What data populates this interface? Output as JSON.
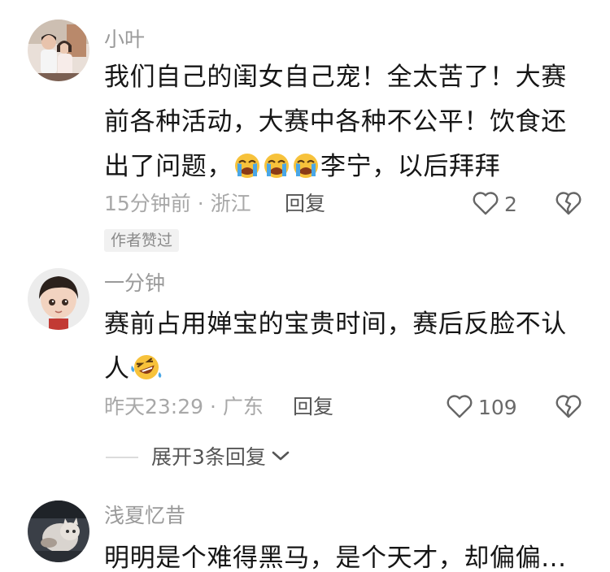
{
  "comments": [
    {
      "username": "小叶",
      "text_a": "我们自己的闺女自己宠！全太苦了！大赛前各种活动，大赛中各种不公平！饮食还出了问题，",
      "text_b": "李宁，以后拜拜",
      "emojis": [
        "loudly-crying-face",
        "loudly-crying-face",
        "loudly-crying-face"
      ],
      "time": "15分钟前",
      "location": "浙江",
      "reply_label": "回复",
      "like_count": "2",
      "author_badge": "作者赞过"
    },
    {
      "username": "一分钟",
      "text_a": "赛前占用婵宝的宝贵时间，赛后反脸不认人",
      "emojis": [
        "rolling-laughing-face"
      ],
      "time": "昨天23:29",
      "location": "广东",
      "reply_label": "回复",
      "like_count": "109",
      "expand_label": "展开3条回复"
    },
    {
      "username": "浅夏忆昔",
      "text_a": "明明是个难得黑马，是个天才，却偏偏..."
    }
  ],
  "meta_separator": "·",
  "colors": {
    "username": "#9a9a9a",
    "body": "#161616",
    "meta": "#a8a8a8",
    "reply": "#555555",
    "badge_bg": "#f1f1f1"
  },
  "icons": [
    "heart-outline-icon",
    "broken-heart-icon",
    "chevron-down-icon"
  ]
}
